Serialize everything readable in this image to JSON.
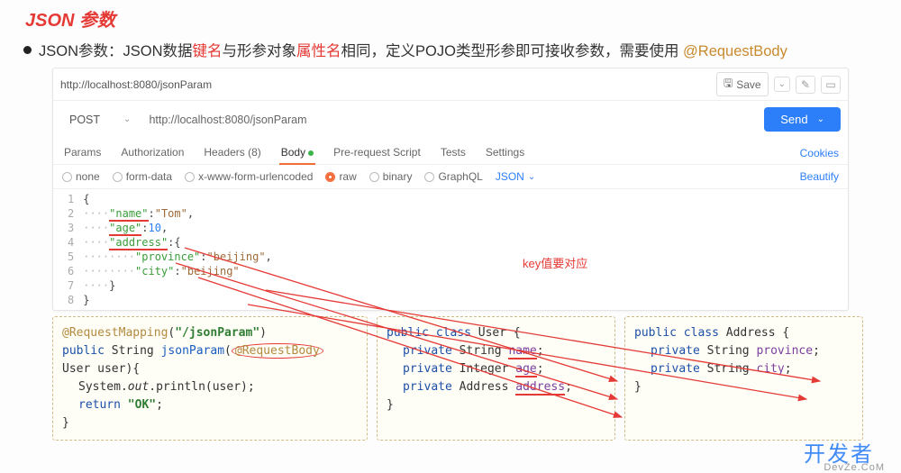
{
  "title": "JSON 参数",
  "desc": {
    "p1": "JSON参数：JSON数据",
    "red1": "键名",
    "p2": "与形参对象",
    "red2": "属性名",
    "p3": "相同，定义POJO类型形参即可接收参数，需要使用 ",
    "gold": "@RequestBody"
  },
  "pm": {
    "url_tab": "http://localhost:8080/jsonParam",
    "save": "Save",
    "method": "POST",
    "url": "http://localhost:8080/jsonParam",
    "send": "Send",
    "tabs": {
      "params": "Params",
      "auth": "Authorization",
      "headers": "Headers (8)",
      "body": "Body",
      "pre": "Pre-request Script",
      "tests": "Tests",
      "settings": "Settings",
      "cookies": "Cookies"
    },
    "radios": {
      "none": "none",
      "form": "form-data",
      "xwww": "x-www-form-urlencoded",
      "raw": "raw",
      "binary": "binary",
      "gql": "GraphQL",
      "json": "JSON",
      "beautify": "Beautify"
    },
    "lines": [
      "1",
      "2",
      "3",
      "4",
      "5",
      "6",
      "7",
      "8"
    ],
    "json": {
      "open": "{",
      "name_k": "\"name\"",
      "name_v": "\"Tom\"",
      "age_k": "\"age\"",
      "age_v": "10",
      "addr_k": "\"address\"",
      "prov_k": "\"province\"",
      "prov_v": "\"beijing\"",
      "city_k": "\"city\"",
      "city_v": "\"beijing\"",
      "close": "}"
    }
  },
  "note": "key值要对应",
  "code1": {
    "l1a": "@RequestMapping",
    "l1b": "(",
    "l1c": "\"/jsonParam\"",
    "l1d": ")",
    "l2a": "public",
    "l2b": " String ",
    "l2c": "jsonParam",
    "l2d": "(",
    "l2e": "@RequestBody",
    "l2f": " User user){",
    "l3a": "System.",
    "l3b": "out",
    "l3c": ".println(user);",
    "l4a": "return ",
    "l4b": "\"OK\"",
    "l4c": ";",
    "l5": "}"
  },
  "code2": {
    "l1a": "public class",
    "l1b": " User {",
    "l2a": "private",
    "l2b": " String ",
    "l2c": "name",
    "l2d": ";",
    "l3a": "private",
    "l3b": " Integer ",
    "l3c": "age",
    "l3d": ";",
    "l4a": "private",
    "l4b": " Address ",
    "l4c": "address",
    "l4d": ";",
    "l5": "}"
  },
  "code3": {
    "l1a": "public class",
    "l1b": " Address {",
    "l2a": "private",
    "l2b": " String ",
    "l2c": "province",
    "l2d": ";",
    "l3a": "private",
    "l3b": " String ",
    "l3c": "city",
    "l3d": ";",
    "l4": "}"
  },
  "wm": "开发者",
  "wm2": "DevZe.CoM"
}
